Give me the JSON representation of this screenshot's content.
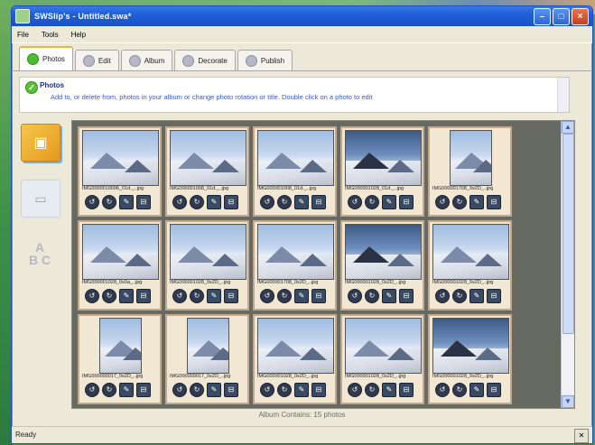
{
  "window": {
    "title": "SWSlip's - Untitled.swa*",
    "minimize": "–",
    "maximize": "□",
    "close": "×"
  },
  "menu": [
    "File",
    "Tools",
    "Help"
  ],
  "tabs": [
    {
      "label": "Photos",
      "active": true
    },
    {
      "label": "Edit",
      "active": false
    },
    {
      "label": "Album",
      "active": false
    },
    {
      "label": "Decorate",
      "active": false
    },
    {
      "label": "Publish",
      "active": false
    }
  ],
  "info": {
    "title": "Photos",
    "text": "Add to, or delete from, photos in your album or change photo rotation or title. Double click on a photo to edit"
  },
  "side": {
    "abc_label": "A\nB C"
  },
  "photos": [
    {
      "file": "IMG0000010006_01d._..jpg",
      "portrait": false,
      "dark": false
    },
    {
      "file": "IMG000001008_01d._..jpg",
      "portrait": false,
      "dark": false
    },
    {
      "file": "IMG000001008_01d._..jpg",
      "portrait": false,
      "dark": false
    },
    {
      "file": "IMG000001028_01d._..jpg",
      "portrait": false,
      "dark": true
    },
    {
      "file": "IMG000001708_0s2D_..jpg",
      "portrait": true,
      "dark": false
    },
    {
      "file": "IMG000001028_0s0a_..jpg",
      "portrait": false,
      "dark": false
    },
    {
      "file": "IMG000001028_0s2D_..jpg",
      "portrait": false,
      "dark": false
    },
    {
      "file": "IMG000001708_0s2D_..jpg",
      "portrait": false,
      "dark": false
    },
    {
      "file": "IMG000001028_0s2D_..jpg",
      "portrait": false,
      "dark": true
    },
    {
      "file": "IMG000001028_0s2D_..jpg",
      "portrait": false,
      "dark": false
    },
    {
      "file": "IMG000000017_0s2D_..jpg",
      "portrait": true,
      "dark": false
    },
    {
      "file": "IMG000000017_0s2D_..jpg",
      "portrait": true,
      "dark": false
    },
    {
      "file": "IMG000001028_0s2D_..jpg",
      "portrait": false,
      "dark": false
    },
    {
      "file": "IMG000001028_0s2D_..jpg",
      "portrait": false,
      "dark": false
    },
    {
      "file": "IMG000001028_0s2D_..jpg",
      "portrait": false,
      "dark": true
    }
  ],
  "actions": [
    "↺",
    "↻",
    "✎",
    "⊟"
  ],
  "gallery_status": "Album Contains: 15 photos",
  "status": {
    "text": "Ready",
    "button": "✕"
  }
}
